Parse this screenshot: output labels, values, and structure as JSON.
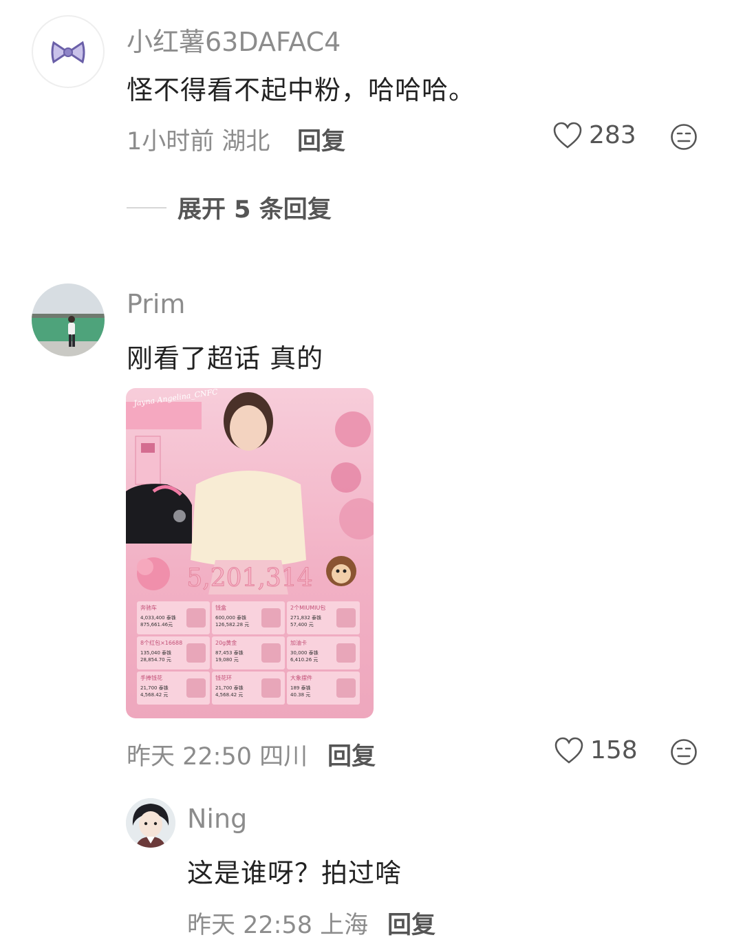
{
  "comments": [
    {
      "username": "小红薯63DAFAC4",
      "content": "怪不得看不起中粉，哈哈哈。",
      "meta": "1小时前 湖北",
      "reply_label": "回复",
      "likes": "283",
      "avatar_icon": "bow-icon",
      "expand_label": "展开 5 条回复"
    },
    {
      "username": "Prim",
      "content": "刚看了超话 真的",
      "meta": "昨天 22:50 四川",
      "reply_label": "回复",
      "likes": "158",
      "avatar_icon": "lake-photo",
      "image": {
        "banner": "Jayna Angelina_CNFC",
        "total": "5,201,314",
        "gifts": [
          {
            "name": "奔驰车",
            "line1": "4,033,400 泰铢",
            "line2": "875,661.46元"
          },
          {
            "name": "钱盒",
            "line1": "600,000 泰铢",
            "line2": "126,582.28 元"
          },
          {
            "name": "2个MIUMIU包",
            "line1": "271,832 泰铢",
            "line2": "57,400 元"
          },
          {
            "name": "8个红包×16688",
            "line1": "135,040 泰铢",
            "line2": "28,854.70 元"
          },
          {
            "name": "20g黄金",
            "line1": "87,453 泰铢",
            "line2": "19,080 元"
          },
          {
            "name": "加油卡",
            "line1": "30,000 泰铢",
            "line2": "6,410.26 元"
          },
          {
            "name": "手捧钱花",
            "line1": "21,700 泰铢",
            "line2": "4,568.42 元"
          },
          {
            "name": "钱花环",
            "line1": "21,700 泰铢",
            "line2": "4,568.42 元"
          },
          {
            "name": "大象摆件",
            "line1": "189 泰铢",
            "line2": "40.38 元"
          }
        ]
      }
    }
  ],
  "reply": {
    "username": "Ning",
    "content": "这是谁呀？拍过啥",
    "meta": "昨天 22:58 上海",
    "reply_label": "回复"
  },
  "colors": {
    "meta_gray": "#8c8c8c",
    "image_pink": "#f3b6c8"
  }
}
